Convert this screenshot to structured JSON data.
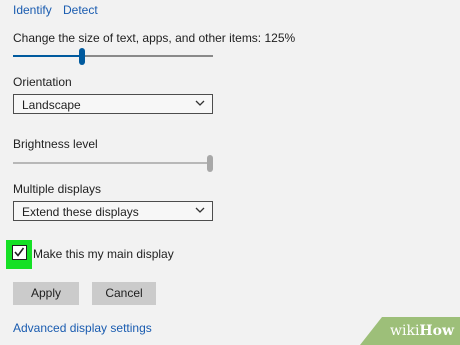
{
  "colors": {
    "accent": "#1a5cb0",
    "slider_fill": "#005a9e",
    "highlight": "#15e025"
  },
  "top_links": {
    "identify": "Identify",
    "detect": "Detect"
  },
  "scale": {
    "label": "Change the size of text, apps, and other items: 125%",
    "value_percent": 34
  },
  "orientation": {
    "label": "Orientation",
    "value": "Landscape"
  },
  "brightness": {
    "label": "Brightness level",
    "value_percent": 100
  },
  "multiple_displays": {
    "label": "Multiple displays",
    "value": "Extend these displays"
  },
  "main_display": {
    "label": "Make this my main display",
    "checked": true
  },
  "buttons": {
    "apply": "Apply",
    "cancel": "Cancel"
  },
  "advanced_link": "Advanced display settings",
  "watermark": {
    "prefix": "wiki",
    "suffix": "How"
  }
}
